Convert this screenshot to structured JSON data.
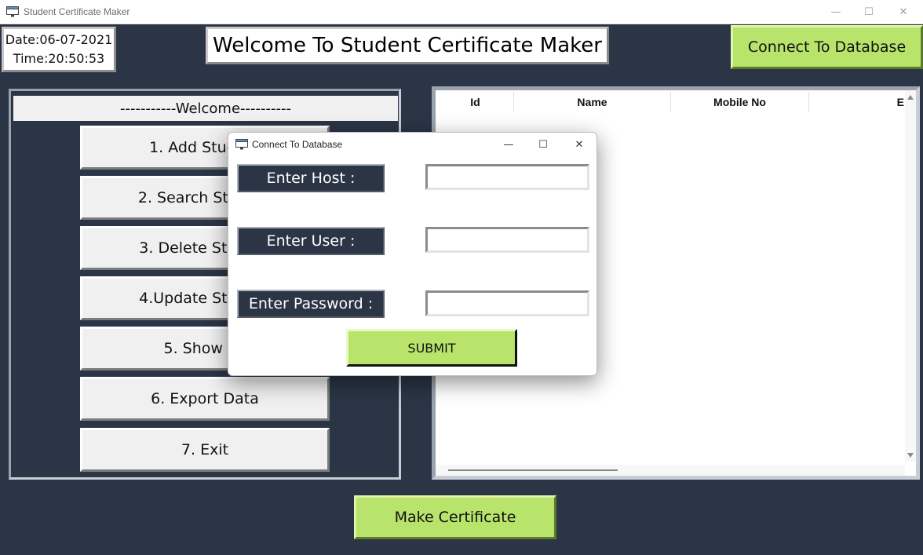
{
  "window": {
    "title": "Student Certificate Maker",
    "controls": {
      "minimize": "—",
      "maximize": "☐",
      "close": "✕"
    }
  },
  "header": {
    "date": "Date:06-07-2021",
    "time": "Time:20:50:53",
    "title": "Welcome To Student Certificate Maker",
    "connect_button": "Connect To Database"
  },
  "menu": {
    "header": "-----------Welcome----------",
    "items": [
      "1. Add Student",
      "2. Search Student",
      "3. Delete Student",
      "4.Update Student",
      "5. Show All",
      "6. Export Data",
      "7. Exit"
    ]
  },
  "table": {
    "columns": [
      "Id",
      "Name",
      "Mobile No",
      "E"
    ]
  },
  "footer": {
    "make_certificate_button": "Make Certificate"
  },
  "dialog": {
    "title": "Connect To Database",
    "controls": {
      "minimize": "—",
      "maximize": "☐",
      "close": "✕"
    },
    "host_label": "Enter Host :",
    "user_label": "Enter User :",
    "password_label": "Enter Password :",
    "host_value": "",
    "user_value": "",
    "password_value": "",
    "submit_label": "SUBMIT"
  },
  "colors": {
    "background": "#2b3546",
    "accent_green": "#b8e46c"
  }
}
